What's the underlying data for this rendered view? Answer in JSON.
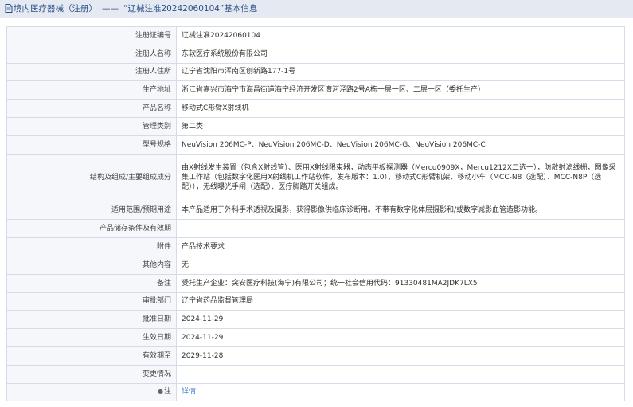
{
  "header": {
    "breadcrumb": "境内医疗器械（注册）",
    "separator": "——",
    "title": "“辽械注准20242060104”基本信息"
  },
  "rows": [
    {
      "label": "注册证编号",
      "value": "辽械注准20242060104"
    },
    {
      "label": "注册人名称",
      "value": "东软医疗系统股份有限公司"
    },
    {
      "label": "注册人住所",
      "value": "辽宁省沈阳市浑南区创新路177-1号"
    },
    {
      "label": "生产地址",
      "value": "浙江省嘉兴市海宁市海昌街道海宁经济开发区漕河泾路2号A栋一层一区、二层一区（委托生产）"
    },
    {
      "label": "产品名称",
      "value": "移动式C形臂X射线机"
    },
    {
      "label": "管理类别",
      "value": "第二类"
    },
    {
      "label": "型号规格",
      "value": "NeuVision 206MC-P、NeuVision 206MC-D、NeuVision 206MC-G、NeuVision 206MC-C"
    },
    {
      "label": "结构及组成/主要组成成分",
      "value": "由X射线发生装置（包含X射线管）、医用X射线限束器，动态平板探测器（Mercu0909X，Mercu1212X二选一），防散射滤线栅，图像采集工作站（包括数字化医用X射线机工作站软件，发布版本：1.0），移动式C形臂机架、移动小车（MCC-N8（选配）、MCC-N8P（选配）），无线曝光手闸（选配）、医疗脚踏开关组成。"
    },
    {
      "label": "适用范围/预期用途",
      "value": "本产品适用于外科手术透视及摄影，获得影像供临床诊断用。不带有数字化体层摄影和/或数字减影血管造影功能。"
    },
    {
      "label": "产品储存条件及有效期",
      "value": ""
    },
    {
      "label": "附件",
      "value": "产品技术要求"
    },
    {
      "label": "其他内容",
      "value": "无"
    },
    {
      "label": "备注",
      "value": "受托生产企业：突安医疗科技(海宁)有限公司；统一社会信用代码：91330481MA2JDK7LX5"
    },
    {
      "label": "审批部门",
      "value": "辽宁省药品监督管理局"
    },
    {
      "label": "批准日期",
      "value": "2024-11-29"
    },
    {
      "label": "生效日期",
      "value": "2024-11-29"
    },
    {
      "label": "有效期至",
      "value": "2029-11-28"
    },
    {
      "label": "变更情况",
      "value": ""
    },
    {
      "label": "注",
      "value": ""
    }
  ],
  "note": {
    "link_label": "详情"
  }
}
